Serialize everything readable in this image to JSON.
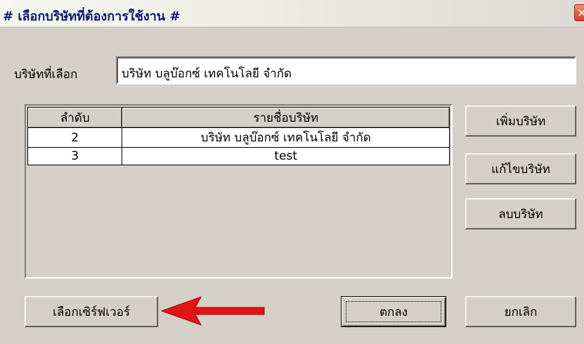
{
  "window": {
    "title": "# เลือกบริษัทที่ต้องการใช้งาน #",
    "close_glyph": "✕"
  },
  "selected": {
    "label": "บริษัทที่เลือก",
    "value": "บริษัท บลูบ๊อกซ์ เทคโนโลยี จำกัด"
  },
  "table": {
    "headers": [
      "ลำดับ",
      "รายชื่อบริษัท"
    ],
    "rows": [
      {
        "idx": "2",
        "name": "บริษัท บลูบ๊อกซ์ เทคโนโลยี จำกัด"
      },
      {
        "idx": "3",
        "name": "test"
      }
    ]
  },
  "buttons": {
    "add": "เพิ่มบริษัท",
    "edit": "แก้ไขบริษัท",
    "delete": "ลบบริษัท",
    "server": "เลือกเซิร์ฟเวอร์",
    "ok": "ตกลง",
    "cancel": "ยกเลิก"
  },
  "annotation": {
    "arrow_color": "#e01515",
    "icon": "red-arrow-left"
  },
  "colors": {
    "window_bg": "#d4d0c8",
    "title_text": "#0b1a6b",
    "close_bg": "#d8412a"
  }
}
